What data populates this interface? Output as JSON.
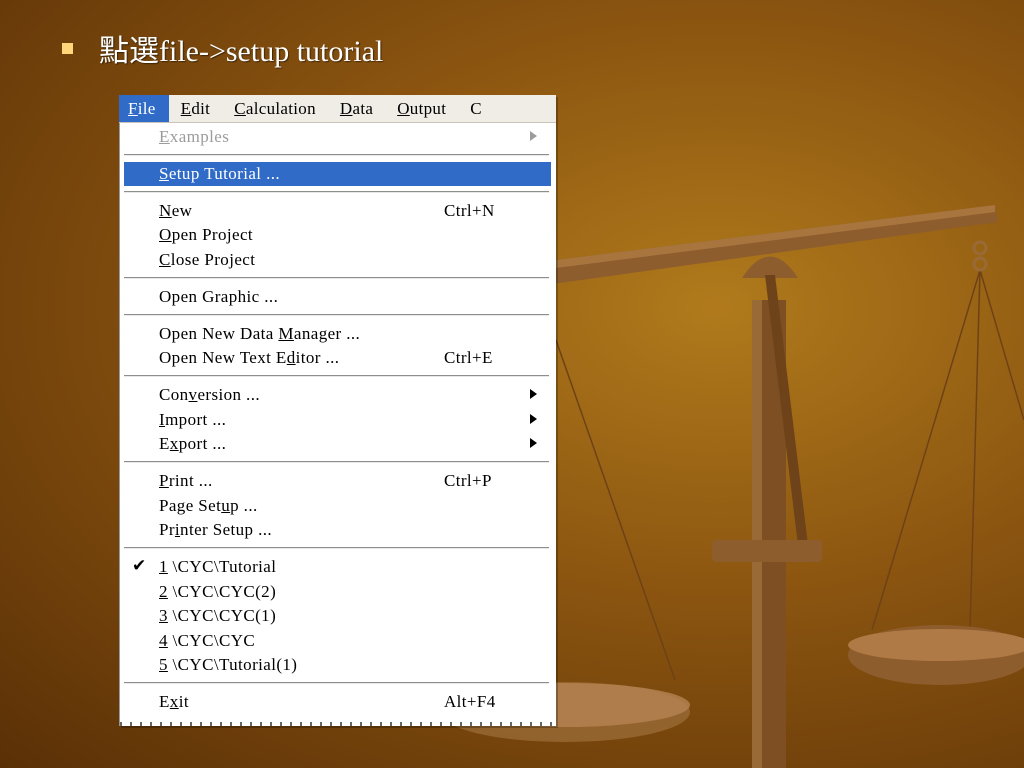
{
  "slide": {
    "title": "點選file->setup tutorial"
  },
  "menubar": {
    "items": [
      {
        "key": "F",
        "rest": "ile"
      },
      {
        "key": "E",
        "rest": "dit"
      },
      {
        "key": "C",
        "rest": "alculation"
      },
      {
        "key": "D",
        "rest": "ata"
      },
      {
        "key": "O",
        "rest": "utput"
      },
      {
        "key": "",
        "rest": "C"
      }
    ]
  },
  "menu": {
    "examples": {
      "pre": "",
      "key": "E",
      "post": "xamples"
    },
    "setup_tutorial": {
      "pre": "",
      "key": "S",
      "post": "etup Tutorial ..."
    },
    "new": {
      "pre": "",
      "key": "N",
      "post": "ew",
      "shortcut": "Ctrl+N"
    },
    "open_project": {
      "pre": "",
      "key": "O",
      "post": "pen Project"
    },
    "close_project": {
      "pre": "",
      "key": "C",
      "post": "lose Project"
    },
    "open_graphic": {
      "pre": "Open Graphic ...",
      "key": "",
      "post": ""
    },
    "open_data_manager": {
      "pre": "Open New Data ",
      "key": "M",
      "post": "anager ..."
    },
    "open_text_editor": {
      "pre": "Open New Text E",
      "key": "d",
      "post": "itor ...",
      "shortcut": "Ctrl+E"
    },
    "conversion": {
      "pre": "Con",
      "key": "v",
      "post": "ersion ..."
    },
    "import": {
      "pre": "",
      "key": "I",
      "post": "mport ..."
    },
    "export": {
      "pre": "E",
      "key": "x",
      "post": "port ..."
    },
    "print": {
      "pre": "",
      "key": "P",
      "post": "rint ...",
      "shortcut": "Ctrl+P"
    },
    "page_setup": {
      "pre": "Page Set",
      "key": "u",
      "post": "p ..."
    },
    "printer_setup": {
      "pre": "Pr",
      "key": "i",
      "post": "nter Setup ..."
    },
    "recent1": {
      "pre": "",
      "key": "1",
      "post": " \\CYC\\Tutorial"
    },
    "recent2": {
      "pre": "",
      "key": "2",
      "post": " \\CYC\\CYC(2)"
    },
    "recent3": {
      "pre": "",
      "key": "3",
      "post": " \\CYC\\CYC(1)"
    },
    "recent4": {
      "pre": "",
      "key": "4",
      "post": " \\CYC\\CYC"
    },
    "recent5": {
      "pre": "",
      "key": "5",
      "post": " \\CYC\\Tutorial(1)"
    },
    "exit": {
      "pre": "E",
      "key": "x",
      "post": "it",
      "shortcut": "Alt+F4"
    },
    "check_mark": "✔"
  }
}
